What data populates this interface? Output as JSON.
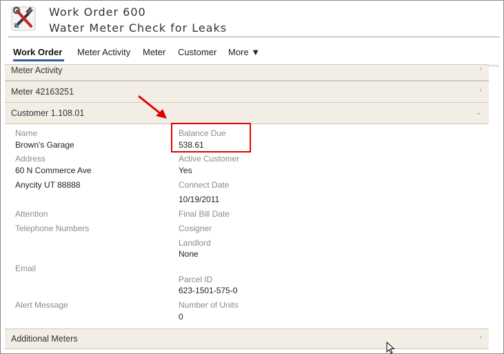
{
  "header": {
    "title_line1": "Work Order 600",
    "title_line2": "Water Meter Check for Leaks",
    "icon": "tools-icon"
  },
  "nav": {
    "items": [
      "Work Order",
      "Meter Activity",
      "Meter",
      "Customer",
      "More ▼"
    ],
    "active": "Work Order"
  },
  "sections": {
    "meter_activity": "Meter Activity",
    "meter": "Meter 42163251",
    "customer": "Customer 1.108.01",
    "additional_meters": "Additional Meters"
  },
  "customer": {
    "name_label": "Name",
    "name_value": "Brown's Garage",
    "address_label": "Address",
    "address_line1": "60 N Commerce Ave",
    "address_line2": "Anycity UT 88888",
    "attention_label": "Attention",
    "telephone_label": "Telephone Numbers",
    "email_label": "Email",
    "alert_label": "Alert Message",
    "balance_label": "Balance Due",
    "balance_value": "538.61",
    "active_label": "Active Customer",
    "active_value": "Yes",
    "connect_label": "Connect Date",
    "connect_value": "10/19/2011",
    "final_bill_label": "Final Bill Date",
    "cosigner_label": "Cosigner",
    "landlord_label": "Landlord",
    "landlord_value": "None",
    "parcel_label": "Parcel ID",
    "parcel_value": "623-1501-575-0",
    "units_label": "Number of Units",
    "units_value": "0"
  },
  "annotation_color": "#e00000"
}
